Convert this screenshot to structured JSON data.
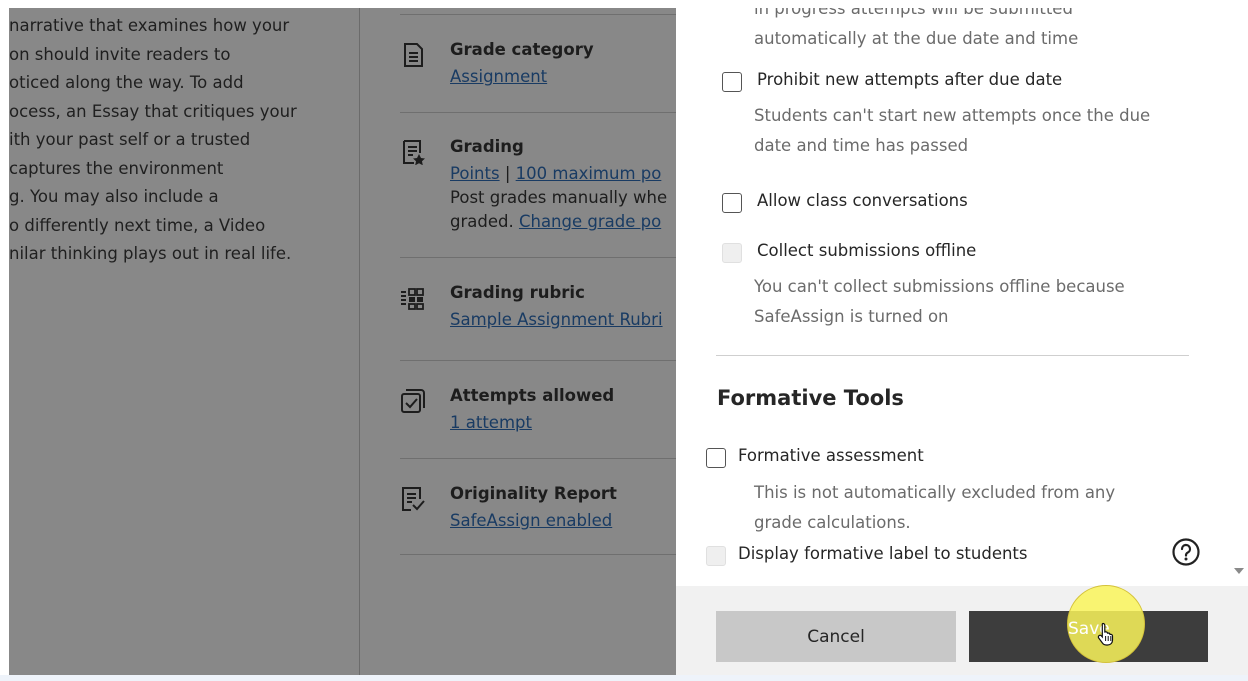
{
  "description_lines": [
    "narrative that examines how your",
    "on should invite readers to",
    "oticed along the way. To add",
    "ocess, an Essay that critiques your",
    "ith your past self or a trusted",
    "captures the environment",
    "g. You may also include a",
    "o differently next time, a Video",
    "nilar thinking plays out in real life."
  ],
  "details": {
    "grade_category": {
      "title": "Grade category",
      "link": "Assignment"
    },
    "grading": {
      "title": "Grading",
      "link_points": "Points",
      "separator": "|",
      "link_max": "100 maximum po",
      "text_line1": "Post grades manually whe",
      "text_line2_prefix": "graded.",
      "link_change": "Change grade po"
    },
    "grading_rubric": {
      "title": "Grading rubric",
      "link": "Sample Assignment Rubri"
    },
    "attempts_allowed": {
      "title": "Attempts allowed",
      "link": "1 attempt"
    },
    "originality_report": {
      "title": "Originality Report",
      "link": "SafeAssign enabled"
    }
  },
  "panel": {
    "top_help_partial": "in progress attempts will be submitted",
    "top_help_line2": "automatically at the due date and time",
    "prohibit": {
      "label": "Prohibit new attempts after due date",
      "help_line1": "Students can't start new attempts once the due",
      "help_line2": "date and time has passed"
    },
    "class_conversations": {
      "label": "Allow class conversations"
    },
    "offline": {
      "label": "Collect submissions offline",
      "help_line1": "You can't collect submissions offline because",
      "help_line2": "SafeAssign is turned on"
    },
    "formative_section_title": "Formative Tools",
    "formative_assessment": {
      "label": "Formative assessment",
      "help_line1": "This is not automatically excluded from any",
      "help_line2": "grade calculations."
    },
    "display_formative": {
      "label": "Display formative label to students"
    }
  },
  "footer": {
    "cancel_label": "Cancel",
    "save_label": "Save"
  }
}
